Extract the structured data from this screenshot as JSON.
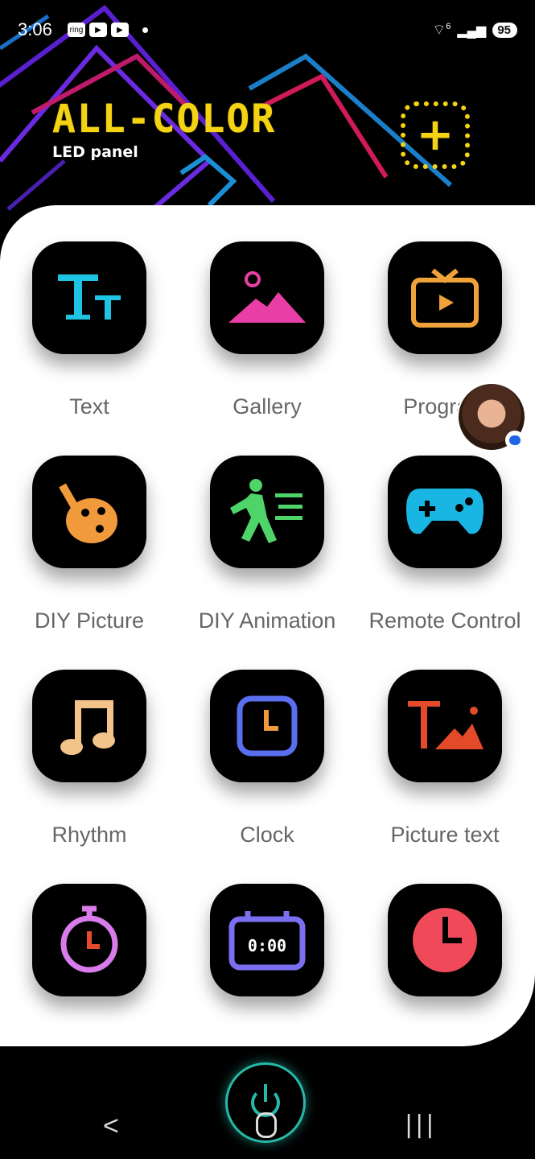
{
  "status_bar": {
    "time": "3:06",
    "app_badges": [
      "ring",
      "video-icon",
      "video-icon"
    ],
    "signal_super": "6",
    "battery": "95"
  },
  "header": {
    "logo_text": "ALL-COLOR",
    "subtitle": "LED panel",
    "add_icon": "plus-icon",
    "accent_color": "#f4d313"
  },
  "tiles": [
    {
      "label": "Text",
      "icon": "text-icon",
      "color": "#1fc3e4"
    },
    {
      "label": "Gallery",
      "icon": "image-icon",
      "color": "#e83ea6"
    },
    {
      "label": "Program",
      "icon": "tv-icon",
      "color": "#f0a23a"
    },
    {
      "label": "DIY Picture",
      "icon": "palette-icon",
      "color": "#f09a3c"
    },
    {
      "label": "DIY Animation",
      "icon": "running-icon",
      "color": "#4fd46a"
    },
    {
      "label": "Remote Control",
      "icon": "gamepad-icon",
      "color": "#19b6e4"
    },
    {
      "label": "Rhythm",
      "icon": "music-note-icon",
      "color": "#f2c38a"
    },
    {
      "label": "Clock",
      "icon": "clock-icon",
      "color": "#5a6ff0"
    },
    {
      "label": "Picture text",
      "icon": "picture-text-icon",
      "color": "#e24a2a"
    },
    {
      "label": "",
      "icon": "stopwatch-icon",
      "color": "#d77ce8"
    },
    {
      "label": "",
      "icon": "countdown-icon",
      "color": "#7a6ff0"
    },
    {
      "label": "",
      "icon": "timer-icon",
      "color": "#f04a5a"
    }
  ],
  "nav": {
    "back_glyph": "<",
    "recent_glyph": "|||"
  }
}
